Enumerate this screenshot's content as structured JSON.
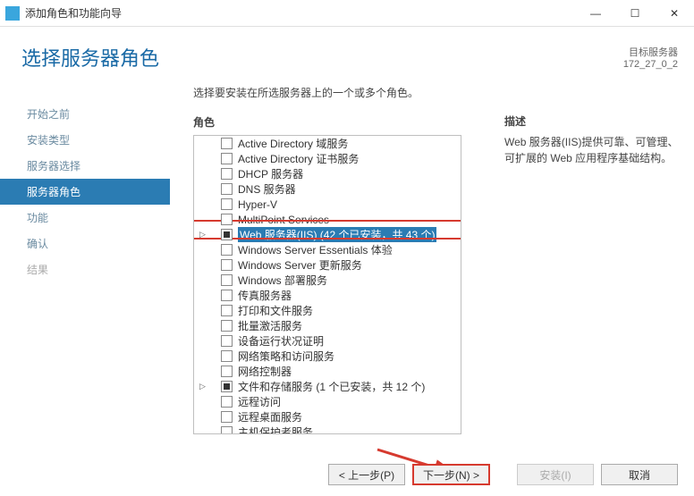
{
  "window": {
    "title": "添加角色和功能向导",
    "server_label": "目标服务器",
    "server_name": "172_27_0_2"
  },
  "page": {
    "title": "选择服务器角色",
    "instruction": "选择要安装在所选服务器上的一个或多个角色。",
    "roles_label": "角色",
    "desc_label": "描述",
    "desc_text": "Web 服务器(IIS)提供可靠、可管理、可扩展的 Web 应用程序基础结构。"
  },
  "nav": {
    "items": [
      {
        "label": "开始之前",
        "state": "normal"
      },
      {
        "label": "安装类型",
        "state": "normal"
      },
      {
        "label": "服务器选择",
        "state": "normal"
      },
      {
        "label": "服务器角色",
        "state": "active"
      },
      {
        "label": "功能",
        "state": "normal"
      },
      {
        "label": "确认",
        "state": "normal"
      },
      {
        "label": "结果",
        "state": "disabled"
      }
    ]
  },
  "roles": [
    {
      "label": "Active Directory 域服务",
      "cb": "empty"
    },
    {
      "label": "Active Directory 证书服务",
      "cb": "empty"
    },
    {
      "label": "DHCP 服务器",
      "cb": "empty"
    },
    {
      "label": "DNS 服务器",
      "cb": "empty"
    },
    {
      "label": "Hyper-V",
      "cb": "empty"
    },
    {
      "label": "MultiPoint Services",
      "cb": "empty"
    },
    {
      "label": "Web 服务器(IIS) (42 个已安装，共 43 个)",
      "cb": "partial",
      "selected": true,
      "arrow": true
    },
    {
      "label": "Windows Server Essentials 体验",
      "cb": "empty"
    },
    {
      "label": "Windows Server 更新服务",
      "cb": "empty"
    },
    {
      "label": "Windows 部署服务",
      "cb": "empty"
    },
    {
      "label": "传真服务器",
      "cb": "empty"
    },
    {
      "label": "打印和文件服务",
      "cb": "empty"
    },
    {
      "label": "批量激活服务",
      "cb": "empty"
    },
    {
      "label": "设备运行状况证明",
      "cb": "empty"
    },
    {
      "label": "网络策略和访问服务",
      "cb": "empty"
    },
    {
      "label": "网络控制器",
      "cb": "empty"
    },
    {
      "label": "文件和存储服务 (1 个已安装，共 12 个)",
      "cb": "partial",
      "arrow": true
    },
    {
      "label": "远程访问",
      "cb": "empty"
    },
    {
      "label": "远程桌面服务",
      "cb": "empty"
    },
    {
      "label": "主机保护者服务",
      "cb": "empty"
    }
  ],
  "buttons": {
    "prev": "< 上一步(P)",
    "next": "下一步(N) >",
    "install": "安装(I)",
    "cancel": "取消"
  }
}
